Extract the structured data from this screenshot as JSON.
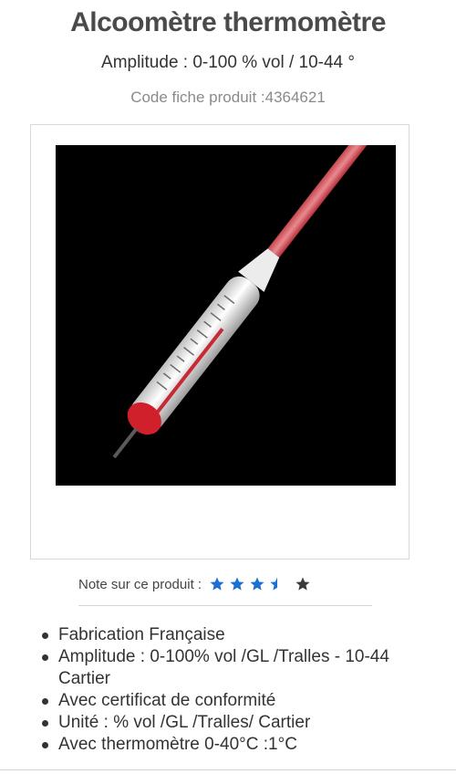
{
  "product": {
    "title": "Alcoomètre thermomètre",
    "subtitle": "Amplitude : 0-100 % vol / 10-44 °",
    "code": "Code fiche produit :4364621"
  },
  "image": {
    "description_icon": "alcoholmeter-thermometer-photo",
    "background": "#000000"
  },
  "rating": {
    "label": "Note sur ce produit :",
    "value": 3.5,
    "max": 5,
    "star_color": "#1a6fd1",
    "empty_star_color": "#3a3a3a"
  },
  "features": [
    "Fabrication Française",
    "Amplitude : 0-100% vol /GL /Tralles - 10-44 Cartier",
    "Avec certificat de conformité",
    "Unité : % vol /GL /Tralles/ Cartier",
    "Avec thermomètre 0-40°C :1°C"
  ]
}
